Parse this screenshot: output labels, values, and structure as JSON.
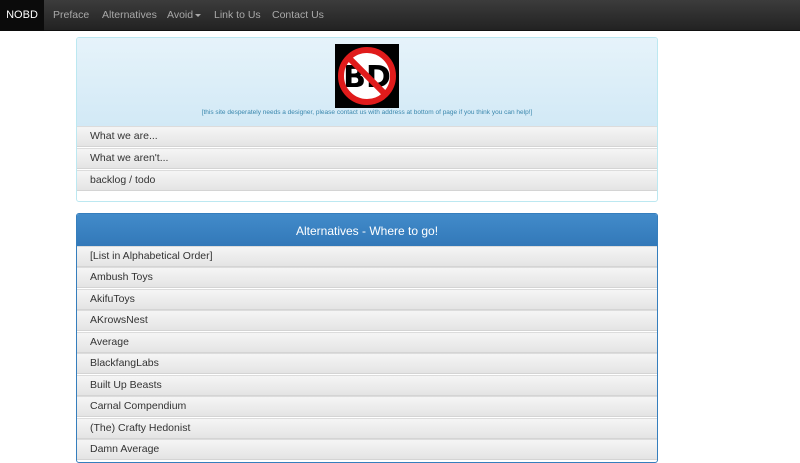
{
  "navbar": {
    "brand": "NOBD",
    "items": [
      {
        "label": "Preface"
      },
      {
        "label": "Alternatives"
      },
      {
        "label": "Avoid"
      },
      {
        "label": "Link to Us"
      },
      {
        "label": "Contact Us"
      }
    ]
  },
  "header_panel": {
    "logo_text": "BD",
    "note": "[this site desperately needs a designer, please contact us with address at bottom of page if you think you can help!]",
    "items": [
      {
        "label": "What we are..."
      },
      {
        "label": "What we aren't..."
      },
      {
        "label": "backlog / todo"
      }
    ]
  },
  "alternatives_panel": {
    "title": "Alternatives - Where to go!",
    "items": [
      {
        "label": "[List in Alphabetical Order]"
      },
      {
        "label": "Ambush Toys"
      },
      {
        "label": "AkifuToys"
      },
      {
        "label": "AKrowsNest"
      },
      {
        "label": "Average"
      },
      {
        "label": "BlackfangLabs"
      },
      {
        "label": "Built Up Beasts"
      },
      {
        "label": "Carnal Compendium"
      },
      {
        "label": "(The) Crafty Hedonist"
      },
      {
        "label": "Damn Average"
      }
    ]
  },
  "colors": {
    "navbar_bg": "#2b2b2b",
    "info_panel_bg": "#d9edf7",
    "primary_panel_bg": "#428bca",
    "logo_ring": "#e01b1b"
  }
}
